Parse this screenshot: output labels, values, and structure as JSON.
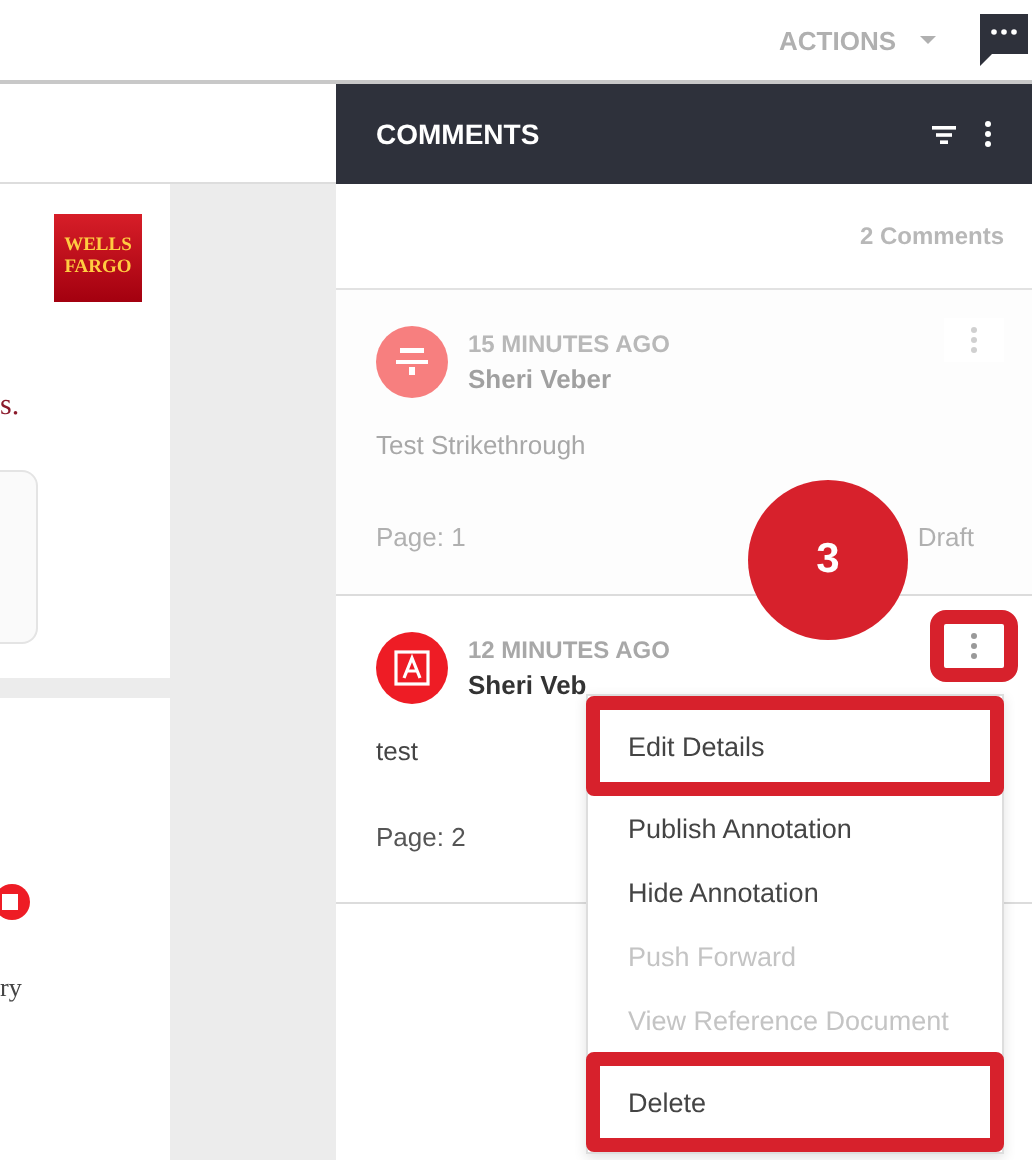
{
  "toolbar": {
    "actions_label": "ACTIONS"
  },
  "document": {
    "logo_lines": [
      "WELLS",
      "FARGO"
    ],
    "fragment_top": "s.",
    "fragment_bottom": "ry"
  },
  "comments_panel": {
    "title": "COMMENTS",
    "count": "2 Comments",
    "comments": [
      {
        "time": "15 MINUTES AGO",
        "author": "Sheri Veber",
        "body": "Test Strikethrough",
        "page": "Page: 1",
        "status": "Draft",
        "kind": "strikethrough",
        "color": "#f77f7f",
        "dimmed": true
      },
      {
        "time": "12 MINUTES AGO",
        "author": "Sheri Veb",
        "body": "test",
        "page": "Page: 2",
        "kind": "text",
        "color": "#ee1c25",
        "dimmed": false
      }
    ]
  },
  "context_menu": {
    "items": [
      {
        "label": "Edit Details",
        "disabled": false,
        "highlighted": true
      },
      {
        "label": "Publish Annotation",
        "disabled": false,
        "highlighted": false
      },
      {
        "label": "Hide Annotation",
        "disabled": false,
        "highlighted": false
      },
      {
        "label": "Push Forward",
        "disabled": true,
        "highlighted": false
      },
      {
        "label": "View Reference Document",
        "disabled": true,
        "highlighted": false
      },
      {
        "label": "Delete",
        "disabled": false,
        "highlighted": true
      }
    ]
  },
  "callout": {
    "step": "3"
  }
}
